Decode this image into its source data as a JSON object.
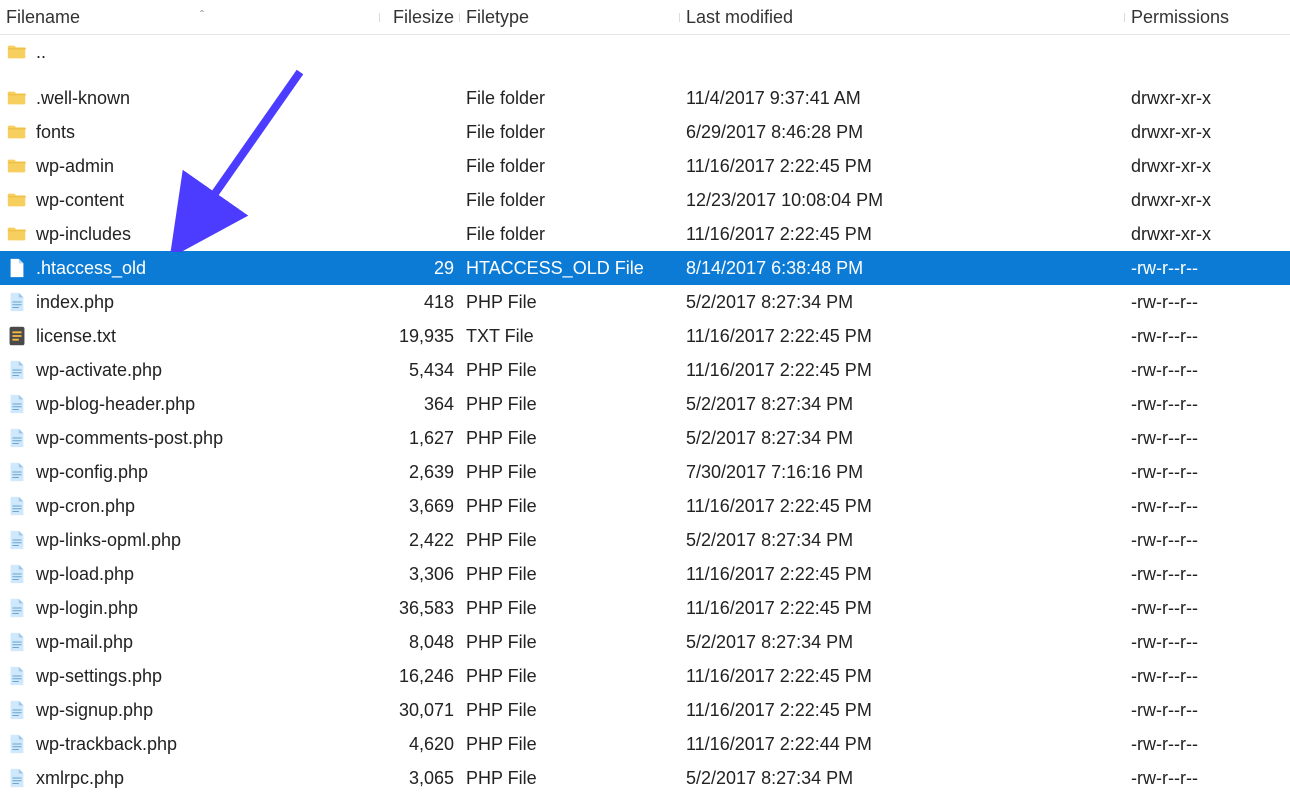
{
  "columns": {
    "filename": "Filename",
    "filesize": "Filesize",
    "filetype": "Filetype",
    "modified": "Last modified",
    "permissions": "Permissions"
  },
  "sort_indicator": "ˆ",
  "arrow_color": "#4c3cff",
  "selected_index": 7,
  "rows": [
    {
      "icon": "folder",
      "name": "..",
      "size": "",
      "type": "",
      "modified": "",
      "perms": ""
    },
    {
      "icon": "folder",
      "name": ".well-known",
      "size": "",
      "type": "File folder",
      "modified": "11/4/2017 9:37:41 AM",
      "perms": "drwxr-xr-x"
    },
    {
      "icon": "folder",
      "name": "fonts",
      "size": "",
      "type": "File folder",
      "modified": "6/29/2017 8:46:28 PM",
      "perms": "drwxr-xr-x"
    },
    {
      "icon": "folder",
      "name": "wp-admin",
      "size": "",
      "type": "File folder",
      "modified": "11/16/2017 2:22:45 PM",
      "perms": "drwxr-xr-x"
    },
    {
      "icon": "folder",
      "name": "wp-content",
      "size": "",
      "type": "File folder",
      "modified": "12/23/2017 10:08:04 PM",
      "perms": "drwxr-xr-x"
    },
    {
      "icon": "folder",
      "name": "wp-includes",
      "size": "",
      "type": "File folder",
      "modified": "11/16/2017 2:22:45 PM",
      "perms": "drwxr-xr-x"
    },
    {
      "icon": "file-sel",
      "name": ".htaccess_old",
      "size": "29",
      "type": "HTACCESS_OLD File",
      "modified": "8/14/2017 6:38:48 PM",
      "perms": "-rw-r--r--"
    },
    {
      "icon": "php",
      "name": "index.php",
      "size": "418",
      "type": "PHP File",
      "modified": "5/2/2017 8:27:34 PM",
      "perms": "-rw-r--r--"
    },
    {
      "icon": "txt",
      "name": "license.txt",
      "size": "19,935",
      "type": "TXT File",
      "modified": "11/16/2017 2:22:45 PM",
      "perms": "-rw-r--r--"
    },
    {
      "icon": "php",
      "name": "wp-activate.php",
      "size": "5,434",
      "type": "PHP File",
      "modified": "11/16/2017 2:22:45 PM",
      "perms": "-rw-r--r--"
    },
    {
      "icon": "php",
      "name": "wp-blog-header.php",
      "size": "364",
      "type": "PHP File",
      "modified": "5/2/2017 8:27:34 PM",
      "perms": "-rw-r--r--"
    },
    {
      "icon": "php",
      "name": "wp-comments-post.php",
      "size": "1,627",
      "type": "PHP File",
      "modified": "5/2/2017 8:27:34 PM",
      "perms": "-rw-r--r--"
    },
    {
      "icon": "php",
      "name": "wp-config.php",
      "size": "2,639",
      "type": "PHP File",
      "modified": "7/30/2017 7:16:16 PM",
      "perms": "-rw-r--r--"
    },
    {
      "icon": "php",
      "name": "wp-cron.php",
      "size": "3,669",
      "type": "PHP File",
      "modified": "11/16/2017 2:22:45 PM",
      "perms": "-rw-r--r--"
    },
    {
      "icon": "php",
      "name": "wp-links-opml.php",
      "size": "2,422",
      "type": "PHP File",
      "modified": "5/2/2017 8:27:34 PM",
      "perms": "-rw-r--r--"
    },
    {
      "icon": "php",
      "name": "wp-load.php",
      "size": "3,306",
      "type": "PHP File",
      "modified": "11/16/2017 2:22:45 PM",
      "perms": "-rw-r--r--"
    },
    {
      "icon": "php",
      "name": "wp-login.php",
      "size": "36,583",
      "type": "PHP File",
      "modified": "11/16/2017 2:22:45 PM",
      "perms": "-rw-r--r--"
    },
    {
      "icon": "php",
      "name": "wp-mail.php",
      "size": "8,048",
      "type": "PHP File",
      "modified": "5/2/2017 8:27:34 PM",
      "perms": "-rw-r--r--"
    },
    {
      "icon": "php",
      "name": "wp-settings.php",
      "size": "16,246",
      "type": "PHP File",
      "modified": "11/16/2017 2:22:45 PM",
      "perms": "-rw-r--r--"
    },
    {
      "icon": "php",
      "name": "wp-signup.php",
      "size": "30,071",
      "type": "PHP File",
      "modified": "11/16/2017 2:22:45 PM",
      "perms": "-rw-r--r--"
    },
    {
      "icon": "php",
      "name": "wp-trackback.php",
      "size": "4,620",
      "type": "PHP File",
      "modified": "11/16/2017 2:22:44 PM",
      "perms": "-rw-r--r--"
    },
    {
      "icon": "php",
      "name": "xmlrpc.php",
      "size": "3,065",
      "type": "PHP File",
      "modified": "5/2/2017 8:27:34 PM",
      "perms": "-rw-r--r--"
    }
  ]
}
